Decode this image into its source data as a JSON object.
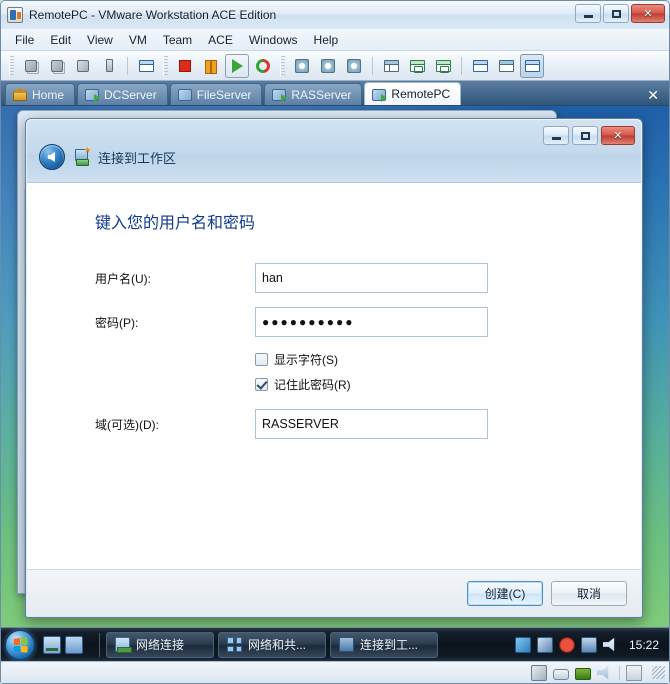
{
  "app": {
    "title": "RemotePC - VMware Workstation ACE Edition",
    "window_buttons": {
      "minimize": "–",
      "maximize": "□",
      "close": "✕"
    }
  },
  "menubar": {
    "items": [
      "File",
      "Edit",
      "View",
      "VM",
      "Team",
      "ACE",
      "Windows",
      "Help"
    ]
  },
  "toolbar": {
    "buttons": [
      {
        "name": "new-team-icon",
        "label": ""
      },
      {
        "name": "new-virtual-machine-icon",
        "label": ""
      },
      {
        "name": "new-ace-package-icon",
        "label": ""
      },
      {
        "name": "usb-device-icon",
        "label": ""
      },
      {
        "name": "open-icon",
        "label": ""
      },
      {
        "name": "power-off-icon",
        "label": ""
      },
      {
        "name": "suspend-icon",
        "label": ""
      },
      {
        "name": "power-on-icon",
        "label": ""
      },
      {
        "name": "reset-icon",
        "label": ""
      },
      {
        "name": "take-snapshot-icon",
        "label": ""
      },
      {
        "name": "revert-snapshot-icon",
        "label": ""
      },
      {
        "name": "manage-snapshots-icon",
        "label": ""
      },
      {
        "name": "show-sidebar-icon",
        "label": ""
      },
      {
        "name": "fullscreen-icon",
        "label": ""
      },
      {
        "name": "quick-switch-icon",
        "label": ""
      },
      {
        "name": "settings-icon",
        "label": ""
      },
      {
        "name": "summary-icon",
        "label": ""
      },
      {
        "name": "console-view-icon",
        "label": ""
      }
    ]
  },
  "tabs": {
    "items": [
      {
        "label": "Home",
        "icon": "home-icon",
        "active": false
      },
      {
        "label": "DCServer",
        "icon": "virtual-machine-running-icon",
        "active": false
      },
      {
        "label": "FileServer",
        "icon": "virtual-machine-icon",
        "active": false
      },
      {
        "label": "RASServer",
        "icon": "virtual-machine-running-icon",
        "active": false
      },
      {
        "label": "RemotePC",
        "icon": "virtual-machine-running-icon",
        "active": true
      }
    ],
    "close_label": "✕"
  },
  "dialog": {
    "title": "连接到工作区",
    "heading": "键入您的用户名和密码",
    "back_label": "←",
    "window_buttons": {
      "minimize": "–",
      "maximize": "□",
      "close": "✕"
    },
    "fields": [
      {
        "label": "用户名(U):",
        "value": "han",
        "name": "username-field"
      },
      {
        "label": "密码(P):",
        "value": "●●●●●●●●●●",
        "name": "password-field"
      },
      {
        "label": "域(可选)(D):",
        "value": "RASSERVER",
        "name": "domain-field"
      }
    ],
    "checkboxes": [
      {
        "label": "显示字符(S)",
        "checked": false,
        "name": "show-characters-checkbox"
      },
      {
        "label": "记住此密码(R)",
        "checked": true,
        "name": "remember-password-checkbox"
      }
    ],
    "buttons": {
      "create": "创建(C)",
      "cancel": "取消"
    }
  },
  "taskbar": {
    "start_label": "",
    "quick_launch": [
      "show-desktop-icon",
      "switch-window-icon"
    ],
    "items": [
      {
        "label": "网络连接",
        "icon": "network-connections-icon"
      },
      {
        "label": "网络和共...",
        "icon": "network-sharing-center-icon"
      },
      {
        "label": "连接到工...",
        "icon": "connect-to-workspace-icon"
      }
    ],
    "tray_icons": [
      "action-center-icon",
      "vmware-tools-icon",
      "security-alert-icon",
      "network-icon",
      "volume-icon"
    ],
    "clock": "15:22"
  },
  "statusbar": {
    "icons": [
      "hard-disk-icon",
      "removable-device-icon",
      "network-adapter-icon",
      "sound-card-icon",
      "printer-icon"
    ]
  },
  "colors": {
    "accent_blue": "#123a8f",
    "title_blue": "#1b3a5c",
    "tab_active_bg": "#ffffff",
    "desktop_top": "#1f5fa8",
    "desktop_bottom": "#88cf77"
  }
}
